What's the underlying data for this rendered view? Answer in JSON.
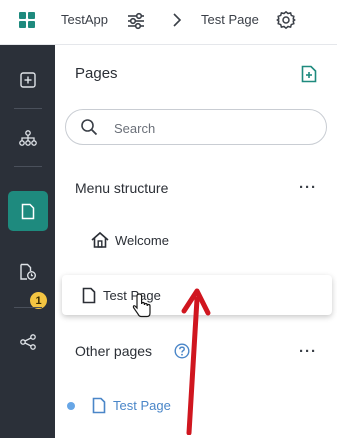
{
  "topbar": {
    "app_name": "TestApp",
    "page_name": "Test Page",
    "icons": [
      "apps-grid-icon",
      "sliders-icon",
      "chevron-right-icon",
      "gear-icon"
    ]
  },
  "rail": {
    "items": [
      {
        "icon": "add-box-icon"
      },
      {
        "icon": "sitemap-icon"
      },
      {
        "icon": "pages-icon",
        "active": true
      },
      {
        "icon": "pending-page-icon",
        "badge": "1"
      },
      {
        "icon": "share-icon"
      }
    ]
  },
  "panel": {
    "title": "Pages",
    "search": {
      "placeholder": "Search"
    },
    "menu_structure": {
      "title": "Menu structure",
      "items": [
        {
          "label": "Welcome",
          "icon": "home-icon"
        },
        {
          "label": "Test Page",
          "icon": "page-icon"
        }
      ]
    },
    "other_pages": {
      "title": "Other pages",
      "items": [
        {
          "label": "Test Page",
          "icon": "page-icon"
        }
      ]
    }
  },
  "colors": {
    "rail_bg": "#2b3039",
    "rail_active": "#1e8a7e",
    "accent_green": "#1e8a7e",
    "badge": "#f4c542",
    "link_blue": "#4a86c8",
    "arrow_red": "#d0161f"
  }
}
